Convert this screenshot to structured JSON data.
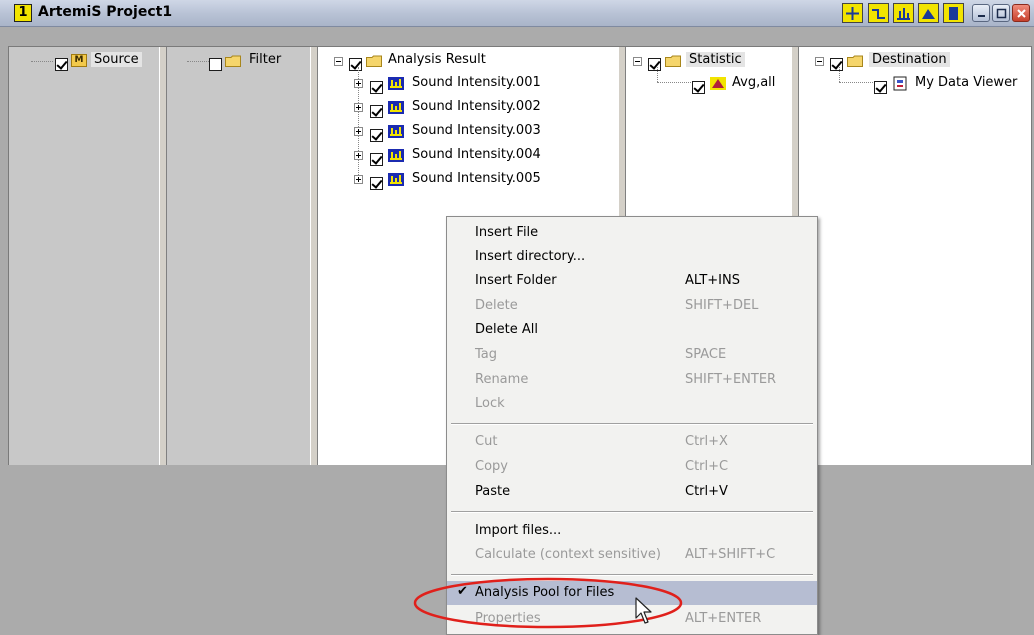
{
  "window": {
    "badge": "1",
    "title": "ArtemiS Project1"
  },
  "toolbar": {
    "buttons": [
      "crosshair-icon",
      "step-icon",
      "spectrum-icon",
      "peak-icon",
      "page-icon"
    ]
  },
  "panes": {
    "source": {
      "label": "Source",
      "badge": "M",
      "checked": true
    },
    "filter": {
      "label": "Filter",
      "checked": false
    },
    "analysis": {
      "root": "Analysis Result",
      "items": [
        "Sound Intensity.001",
        "Sound Intensity.002",
        "Sound Intensity.003",
        "Sound Intensity.004",
        "Sound Intensity.005"
      ]
    },
    "statistic": {
      "root": "Statistic",
      "child": "Avg,all"
    },
    "destination": {
      "root": "Destination",
      "child": "My Data Viewer"
    }
  },
  "context_menu": {
    "items": [
      {
        "label": "Insert File",
        "shortcut": "",
        "enabled": true
      },
      {
        "label": "Insert directory...",
        "shortcut": "",
        "enabled": true
      },
      {
        "label": "Insert Folder",
        "shortcut": "ALT+INS",
        "enabled": true
      },
      {
        "label": "Delete",
        "shortcut": "SHIFT+DEL",
        "enabled": false
      },
      {
        "label": "Delete All",
        "shortcut": "",
        "enabled": true
      },
      {
        "label": "Tag",
        "shortcut": "SPACE",
        "enabled": false
      },
      {
        "label": "Rename",
        "shortcut": "SHIFT+ENTER",
        "enabled": false
      },
      {
        "label": "Lock",
        "shortcut": "",
        "enabled": false
      },
      {
        "label": "Cut",
        "shortcut": "Ctrl+X",
        "enabled": false
      },
      {
        "label": "Copy",
        "shortcut": "Ctrl+C",
        "enabled": false
      },
      {
        "label": "Paste",
        "shortcut": "Ctrl+V",
        "enabled": true
      },
      {
        "label": "Import files...",
        "shortcut": "",
        "enabled": true
      },
      {
        "label": "Calculate (context sensitive)",
        "shortcut": "ALT+SHIFT+C",
        "enabled": false
      },
      {
        "label": "Analysis Pool for Files",
        "shortcut": "",
        "enabled": true,
        "checked": true,
        "selected": true
      },
      {
        "label": "Properties",
        "shortcut": "ALT+ENTER",
        "enabled": false
      }
    ]
  },
  "colors": {
    "accent_yellow": "#f2e400",
    "highlight_oval": "#e0201b",
    "selected_row": "#b6bdd2"
  }
}
